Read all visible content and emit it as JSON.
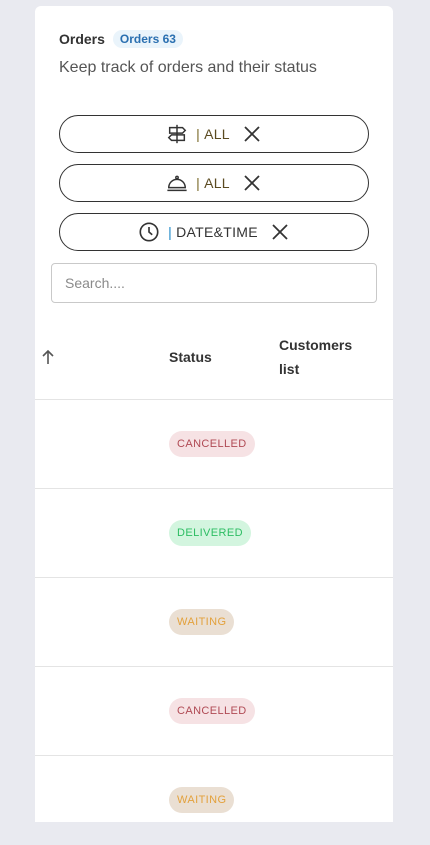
{
  "header": {
    "title": "Orders",
    "badge": "Orders 63",
    "subtitle": "Keep track of orders and their status"
  },
  "filters": [
    {
      "icon": "signpost-icon",
      "separator": "|",
      "value": "ALL"
    },
    {
      "icon": "food-cloche-icon",
      "separator": "|",
      "value": "ALL"
    },
    {
      "icon": "clock-icon",
      "separator": "|",
      "value": "DATE&TIME"
    }
  ],
  "search": {
    "placeholder": "Search....",
    "value": ""
  },
  "table": {
    "columns": [
      "Status",
      "Customers list"
    ],
    "rows": [
      {
        "status": "CANCELLED"
      },
      {
        "status": "DELIVERED"
      },
      {
        "status": "WAITING"
      },
      {
        "status": "CANCELLED"
      },
      {
        "status": "WAITING"
      }
    ]
  },
  "colors": {
    "background": "#e9eaf0",
    "cancelled_bg": "#f6e2e4",
    "cancelled_fg": "#b04a54",
    "delivered_bg": "#d3f5df",
    "delivered_fg": "#2dbd63",
    "waiting_bg": "#eadfd3",
    "waiting_fg": "#e3a13c"
  }
}
